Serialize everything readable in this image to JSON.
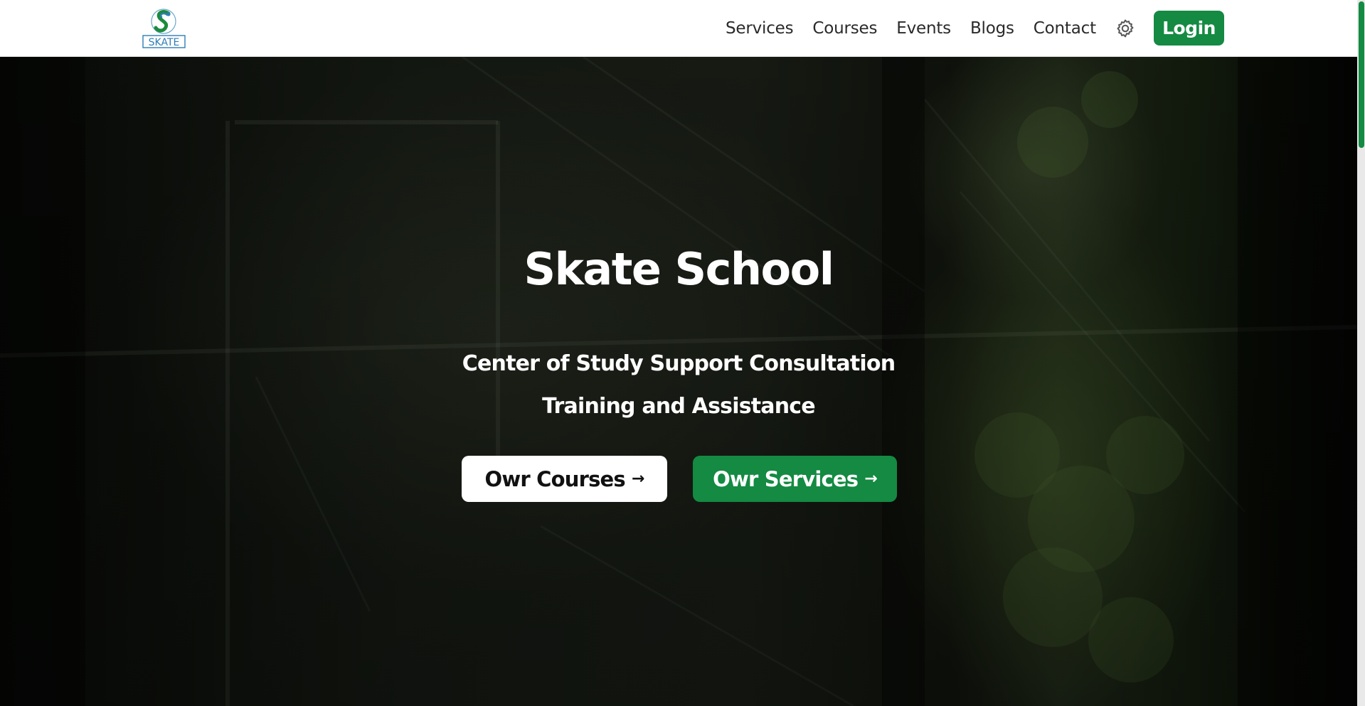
{
  "header": {
    "logo_text": "SKATE",
    "nav": [
      {
        "label": "Services"
      },
      {
        "label": "Courses"
      },
      {
        "label": "Events"
      },
      {
        "label": "Blogs"
      },
      {
        "label": "Contact"
      }
    ],
    "settings_icon": "gear-icon",
    "login_label": "Login"
  },
  "hero": {
    "title": "Skate School",
    "subtitle_line1": "Center of Study Support Consultation",
    "subtitle_line2": "Training and Assistance",
    "buttons": {
      "courses_label": "Owr Courses",
      "services_label": "Owr Services",
      "arrow_icon": "arrow-right-icon",
      "arrow_glyph": "→"
    }
  },
  "colors": {
    "brand_green": "#148a42",
    "header_bg": "#ffffff",
    "nav_text": "#2a2a2a",
    "hero_text": "#ffffff"
  }
}
